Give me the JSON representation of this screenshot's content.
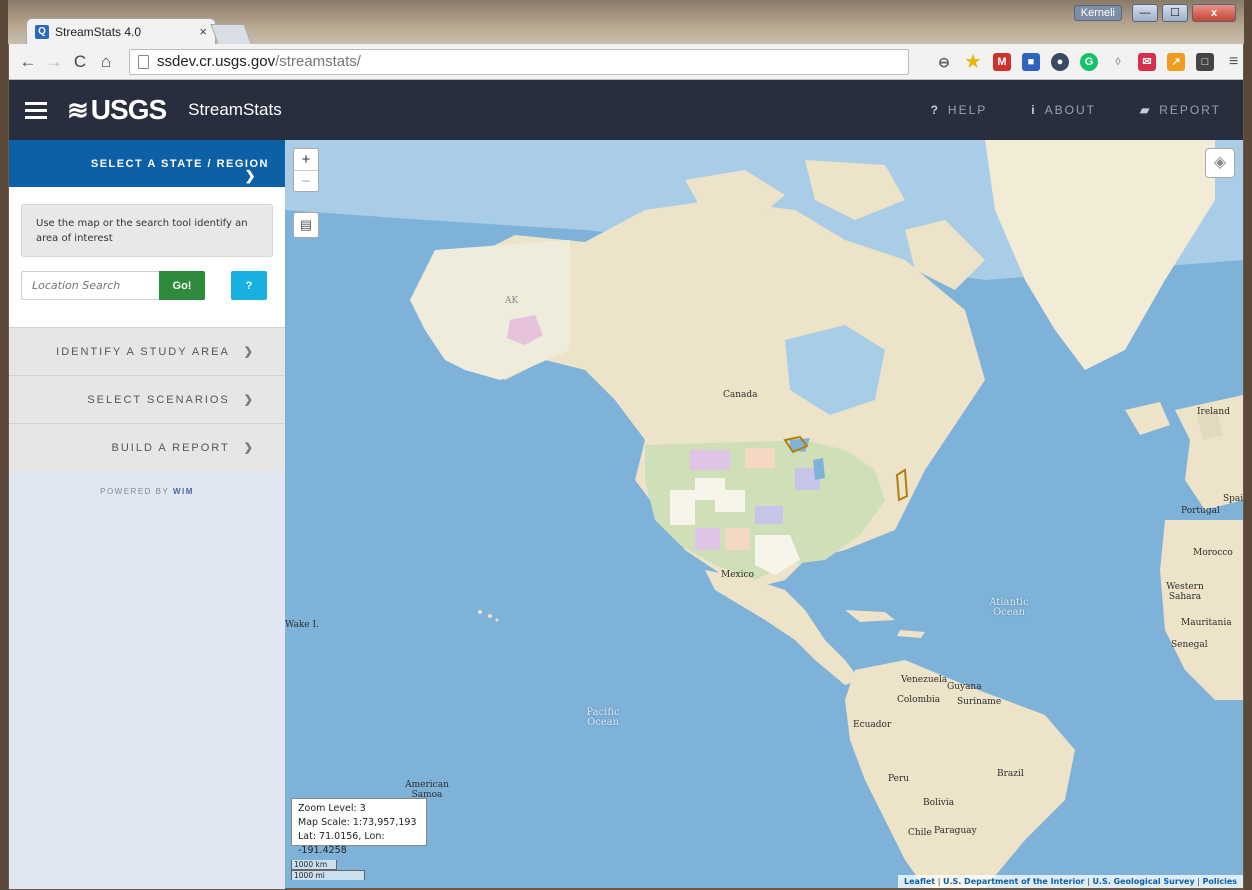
{
  "browser": {
    "tab_title": "StreamStats 4.0",
    "tab_close": "×",
    "user_badge": "Kerneli",
    "url_host": "ssdev.cr.usgs.gov",
    "url_path": "/streamstats/",
    "window_controls": {
      "minimize": "—",
      "maximize": "☐",
      "close": "x"
    },
    "nav": {
      "back": "←",
      "forward": "→",
      "reload": "C",
      "home": "⌂"
    },
    "extensions": [
      "zoom-icon",
      "star-icon",
      "gmail-icon",
      "screenshot-icon",
      "ghostery-icon",
      "grammarly-icon",
      "pocket-icon",
      "inbox-icon",
      "analytics-icon",
      "square-icon"
    ],
    "menu": "≡"
  },
  "header": {
    "logo": "USGS",
    "app_title": "StreamStats",
    "nav": [
      {
        "icon": "question-icon",
        "glyph": "?",
        "label": "HELP"
      },
      {
        "icon": "info-icon",
        "glyph": "i",
        "label": "ABOUT"
      },
      {
        "icon": "report-icon",
        "glyph": "▰",
        "label": "REPORT"
      }
    ]
  },
  "sidebar": {
    "select_state": "SELECT A STATE / REGION",
    "hint": "Use the map or the search tool identify an area of interest",
    "search": {
      "placeholder": "Location Search",
      "go": "Go!",
      "help": "?"
    },
    "sections": [
      {
        "label": "IDENTIFY A STUDY AREA"
      },
      {
        "label": "SELECT SCENARIOS"
      },
      {
        "label": "BUILD A REPORT"
      }
    ],
    "powered_by": "POWERED BY",
    "powered_brand": "WIM"
  },
  "map": {
    "zoom_in": "+",
    "zoom_out": "−",
    "labels": {
      "canada": "Canada",
      "mexico": "Mexico",
      "atlantic": "Atlantic Ocean",
      "pacific": "Pacific Ocean",
      "wake": "Wake I.",
      "american_samoa": "American Samoa",
      "venezuela": "Venezuela",
      "guyana": "Guyana",
      "colombia": "Colombia",
      "suriname": "Suriname",
      "ecuador": "Ecuador",
      "peru": "Peru",
      "brazil": "Brazil",
      "bolivia": "Bolivia",
      "chile": "Chile",
      "paraguay": "Paraguay",
      "portugal": "Portugal",
      "spain": "Spai",
      "morocco": "Morocco",
      "western_sahara": "Western Sahara",
      "mauritania": "Mauritania",
      "senegal": "Senegal",
      "ireland": "Ireland",
      "ak": "AK"
    },
    "info": {
      "zoom": "Zoom Level: 3",
      "scale": "Map Scale: 1:73,957,193",
      "latlon": "Lat: 71.0156, Lon: -191.4258"
    },
    "scale_km": "1000 km",
    "scale_mi": "1000 mi",
    "attribution": {
      "leaflet": "Leaflet",
      "doi": "U.S. Department of the Interior",
      "usgs": "U.S. Geological Survey",
      "policies": "Policies",
      "sep": "|"
    }
  }
}
